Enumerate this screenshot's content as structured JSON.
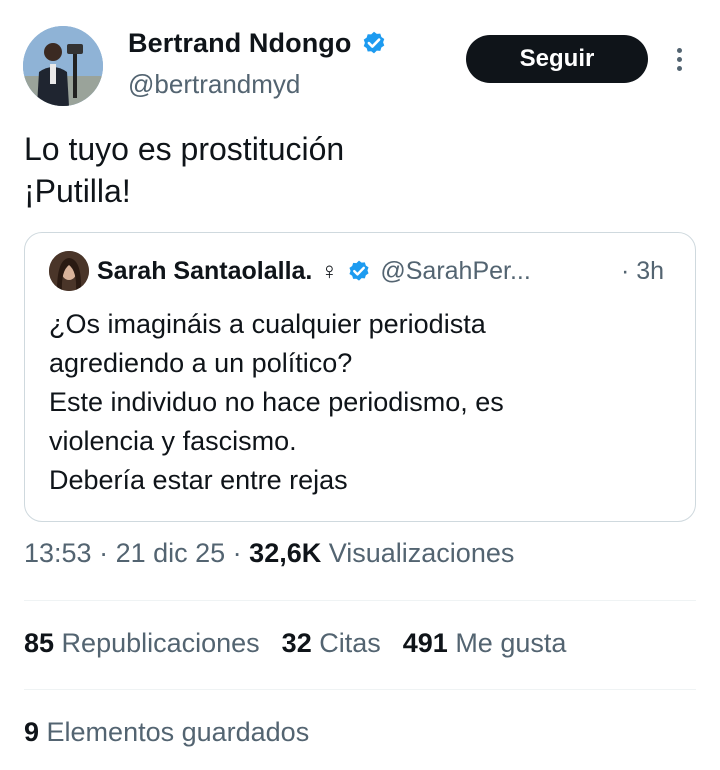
{
  "author": {
    "name": "Bertrand Ndongo",
    "handle": "@bertrandmyd",
    "verified": true,
    "follow_label": "Seguir"
  },
  "tweet": {
    "lines": [
      "Lo tuyo es prostitución",
      "¡Putilla!"
    ]
  },
  "quoted": {
    "name": "Sarah Santaolalla.",
    "symbol": "♀",
    "verified": true,
    "handle": "@SarahPer...",
    "time": "· 3h",
    "lines": [
      "¿Os imagináis a cualquier periodista",
      "agrediendo a un político?",
      "Este individuo no hace periodismo, es",
      "violencia y fascismo.",
      "Debería estar entre rejas"
    ]
  },
  "meta": {
    "time": "13:53",
    "sep1": " · ",
    "date": "21 dic 25",
    "sep2": " · ",
    "views_count": "32,6K",
    "views_label": " Visualizaciones"
  },
  "stats": {
    "reposts_count": "85",
    "reposts_label": " Republicaciones",
    "quotes_count": "32",
    "quotes_label": " Citas",
    "likes_count": "491",
    "likes_label": " Me gusta"
  },
  "saved": {
    "count": "9",
    "label": " Elementos guardados"
  },
  "colors": {
    "verified_blue": "#1d9bf0",
    "text": "#0f1419",
    "secondary": "#536471",
    "border": "#cfd9de",
    "button_bg": "#0f1419"
  },
  "icons": {
    "verified": "verified-badge-icon",
    "more": "more-vertical-icon"
  }
}
